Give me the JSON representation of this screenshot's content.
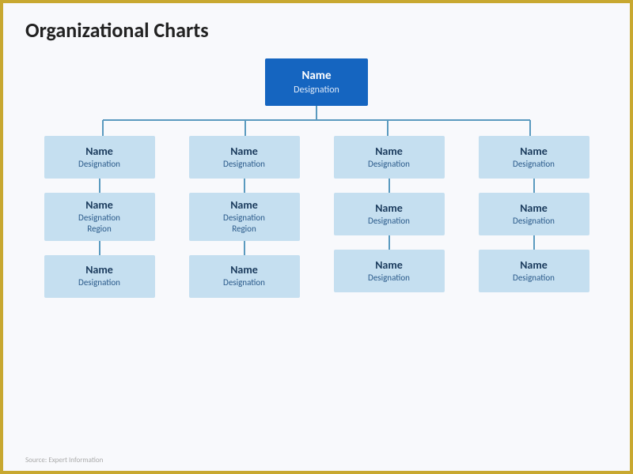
{
  "page": {
    "title": "Organizational Charts",
    "border_color": "#c8a830"
  },
  "root": {
    "name": "Name",
    "designation": "Designation"
  },
  "columns": [
    {
      "id": "col1",
      "level1": {
        "name": "Name",
        "designation": "Designation"
      },
      "level2": {
        "name": "Name",
        "designation": "Designation\nRegion"
      },
      "level3": {
        "name": "Name",
        "designation": "Designation"
      }
    },
    {
      "id": "col2",
      "level1": {
        "name": "Name",
        "designation": "Designation"
      },
      "level2": {
        "name": "Name",
        "designation": "Designation\nRegion"
      },
      "level3": {
        "name": "Name",
        "designation": "Designation"
      }
    },
    {
      "id": "col3",
      "level1": {
        "name": "Name",
        "designation": "Designation"
      },
      "level2": {
        "name": "Name",
        "designation": "Designation"
      },
      "level3": {
        "name": "Name",
        "designation": "Designation"
      }
    },
    {
      "id": "col4",
      "level1": {
        "name": "Name",
        "designation": "Designation"
      },
      "level2": {
        "name": "Name",
        "designation": "Designation"
      },
      "level3": {
        "name": "Name",
        "designation": "Designation"
      }
    }
  ],
  "watermark": "Source: Expert Information"
}
